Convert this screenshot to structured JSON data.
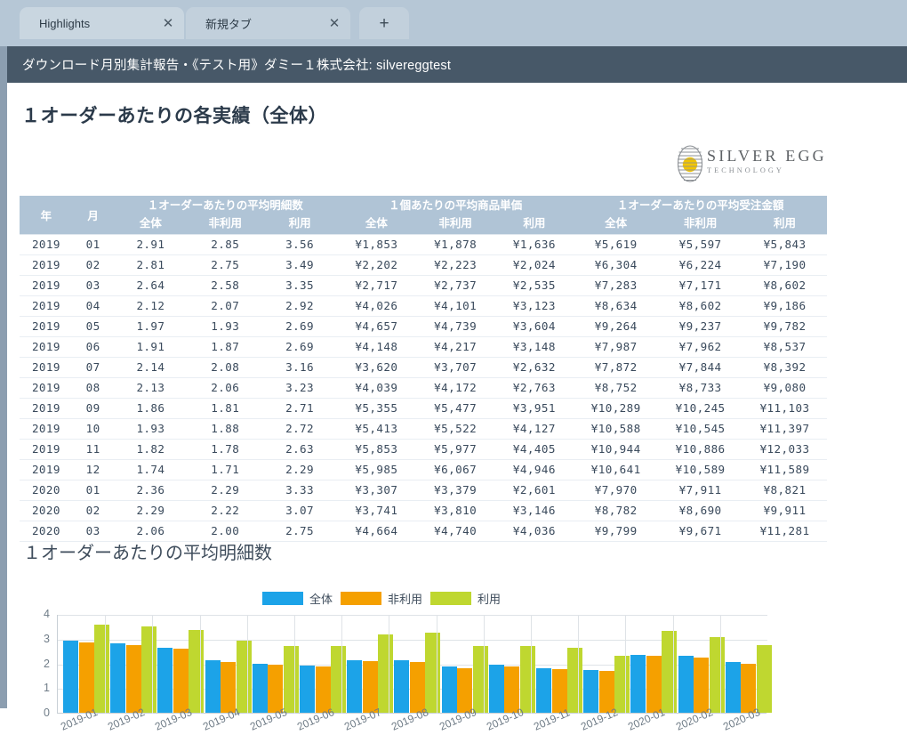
{
  "browser": {
    "tabs": [
      {
        "label": "Highlights",
        "close_icon": "close-icon",
        "active": true
      },
      {
        "label": "新規タブ",
        "close_icon": "close-icon",
        "active": false
      }
    ],
    "new_tab_label": "+",
    "close_glyph": "✕"
  },
  "report": {
    "header_title": "ダウンロード月別集計報告・《テスト用》ダミー１株式会社: silvereggtest",
    "page_title": "１オーダーあたりの各実績（全体）",
    "logo": {
      "name": "SILVER EGG",
      "sub": "TECHNOLOGY"
    }
  },
  "table": {
    "col_year": "年",
    "col_month": "月",
    "groups": [
      "１オーダーあたりの平均明細数",
      "１個あたりの平均商品単価",
      "１オーダーあたりの平均受注金額"
    ],
    "subheaders": [
      "全体",
      "非利用",
      "利用"
    ],
    "rows": [
      [
        "2019",
        "01",
        "2.91",
        "2.85",
        "3.56",
        "¥1,853",
        "¥1,878",
        "¥1,636",
        "¥5,619",
        "¥5,597",
        "¥5,843"
      ],
      [
        "2019",
        "02",
        "2.81",
        "2.75",
        "3.49",
        "¥2,202",
        "¥2,223",
        "¥2,024",
        "¥6,304",
        "¥6,224",
        "¥7,190"
      ],
      [
        "2019",
        "03",
        "2.64",
        "2.58",
        "3.35",
        "¥2,717",
        "¥2,737",
        "¥2,535",
        "¥7,283",
        "¥7,171",
        "¥8,602"
      ],
      [
        "2019",
        "04",
        "2.12",
        "2.07",
        "2.92",
        "¥4,026",
        "¥4,101",
        "¥3,123",
        "¥8,634",
        "¥8,602",
        "¥9,186"
      ],
      [
        "2019",
        "05",
        "1.97",
        "1.93",
        "2.69",
        "¥4,657",
        "¥4,739",
        "¥3,604",
        "¥9,264",
        "¥9,237",
        "¥9,782"
      ],
      [
        "2019",
        "06",
        "1.91",
        "1.87",
        "2.69",
        "¥4,148",
        "¥4,217",
        "¥3,148",
        "¥7,987",
        "¥7,962",
        "¥8,537"
      ],
      [
        "2019",
        "07",
        "2.14",
        "2.08",
        "3.16",
        "¥3,620",
        "¥3,707",
        "¥2,632",
        "¥7,872",
        "¥7,844",
        "¥8,392"
      ],
      [
        "2019",
        "08",
        "2.13",
        "2.06",
        "3.23",
        "¥4,039",
        "¥4,172",
        "¥2,763",
        "¥8,752",
        "¥8,733",
        "¥9,080"
      ],
      [
        "2019",
        "09",
        "1.86",
        "1.81",
        "2.71",
        "¥5,355",
        "¥5,477",
        "¥3,951",
        "¥10,289",
        "¥10,245",
        "¥11,103"
      ],
      [
        "2019",
        "10",
        "1.93",
        "1.88",
        "2.72",
        "¥5,413",
        "¥5,522",
        "¥4,127",
        "¥10,588",
        "¥10,545",
        "¥11,397"
      ],
      [
        "2019",
        "11",
        "1.82",
        "1.78",
        "2.63",
        "¥5,853",
        "¥5,977",
        "¥4,405",
        "¥10,944",
        "¥10,886",
        "¥12,033"
      ],
      [
        "2019",
        "12",
        "1.74",
        "1.71",
        "2.29",
        "¥5,985",
        "¥6,067",
        "¥4,946",
        "¥10,641",
        "¥10,589",
        "¥11,589"
      ],
      [
        "2020",
        "01",
        "2.36",
        "2.29",
        "3.33",
        "¥3,307",
        "¥3,379",
        "¥2,601",
        "¥7,970",
        "¥7,911",
        "¥8,821"
      ],
      [
        "2020",
        "02",
        "2.29",
        "2.22",
        "3.07",
        "¥3,741",
        "¥3,810",
        "¥3,146",
        "¥8,782",
        "¥8,690",
        "¥9,911"
      ],
      [
        "2020",
        "03",
        "2.06",
        "2.00",
        "2.75",
        "¥4,664",
        "¥4,740",
        "¥4,036",
        "¥9,799",
        "¥9,671",
        "¥11,281"
      ]
    ]
  },
  "chart_data": {
    "type": "bar",
    "title": "１オーダーあたりの平均明細数",
    "xlabel": "",
    "ylabel": "",
    "ylim": [
      0,
      4
    ],
    "yticks": [
      0,
      1,
      2,
      3,
      4
    ],
    "grid": true,
    "legend_position": "top-center",
    "categories": [
      "2019-01",
      "2019-02",
      "2019-03",
      "2019-04",
      "2019-05",
      "2019-06",
      "2019-07",
      "2019-08",
      "2019-09",
      "2019-10",
      "2019-11",
      "2019-12",
      "2020-01",
      "2020-02",
      "2020-03"
    ],
    "series": [
      {
        "name": "全体",
        "color": "#1CA3E8",
        "values": [
          2.91,
          2.81,
          2.64,
          2.12,
          1.97,
          1.91,
          2.14,
          2.13,
          1.86,
          1.93,
          1.82,
          1.74,
          2.36,
          2.29,
          2.06
        ]
      },
      {
        "name": "非利用",
        "color": "#F5A000",
        "values": [
          2.85,
          2.75,
          2.58,
          2.07,
          1.93,
          1.87,
          2.08,
          2.06,
          1.81,
          1.88,
          1.78,
          1.71,
          2.29,
          2.22,
          2.0
        ]
      },
      {
        "name": "利用",
        "color": "#BFD730",
        "values": [
          3.56,
          3.49,
          3.35,
          2.92,
          2.69,
          2.69,
          3.16,
          3.23,
          2.71,
          2.72,
          2.63,
          2.29,
          3.33,
          3.07,
          2.75
        ]
      }
    ]
  }
}
